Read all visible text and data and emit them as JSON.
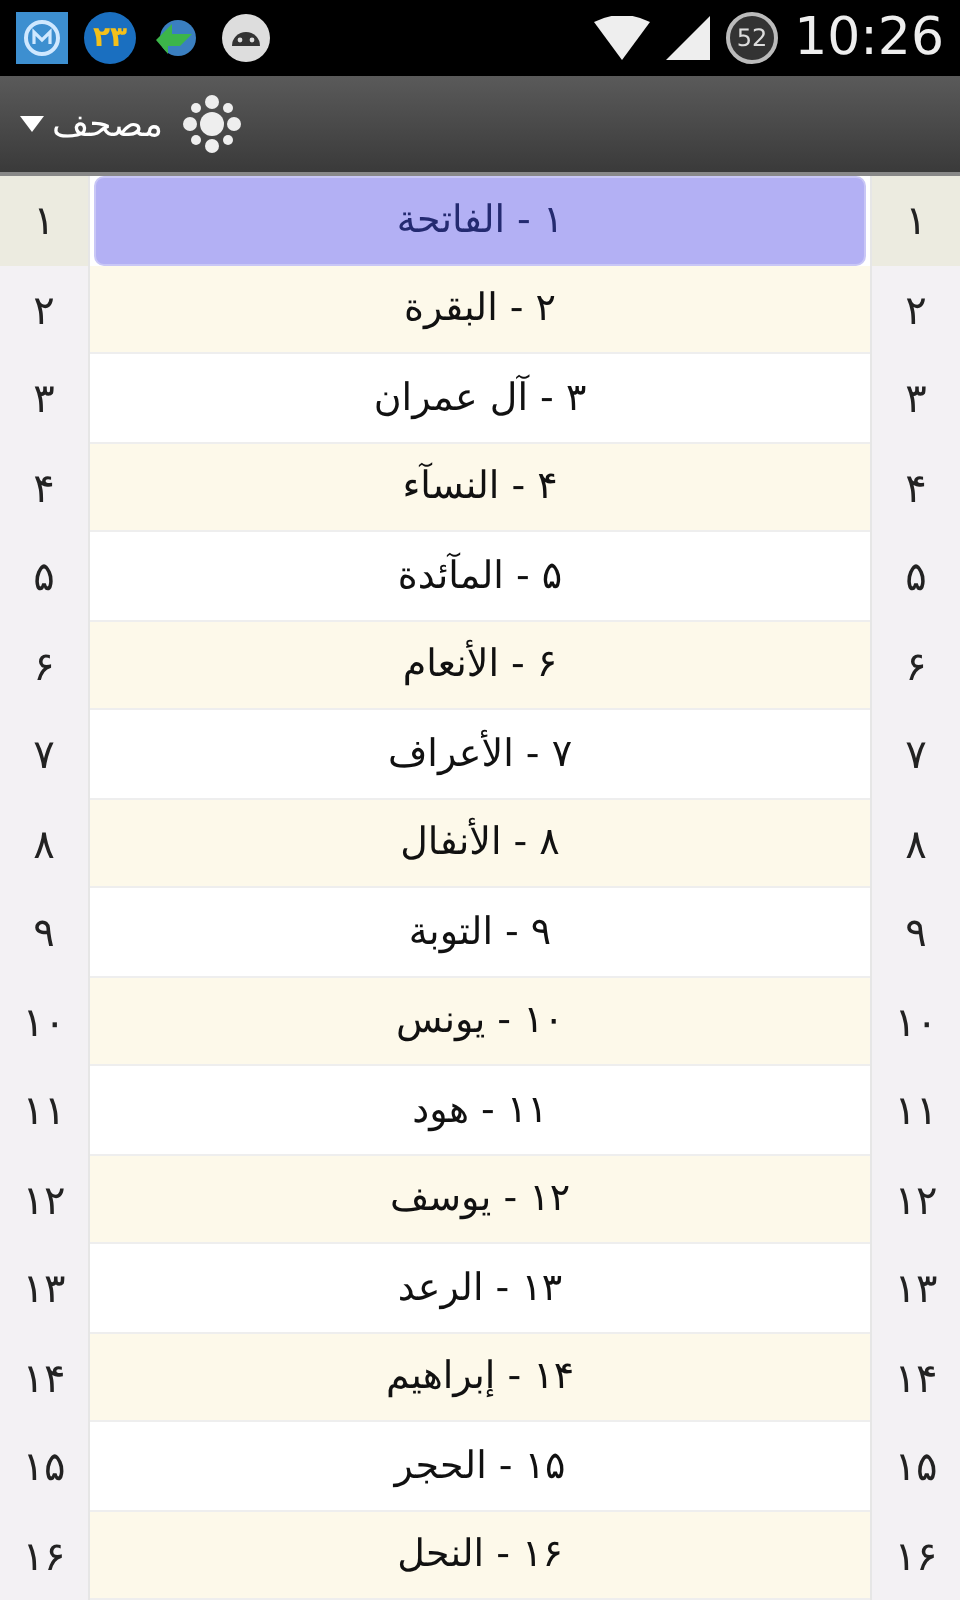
{
  "status_bar": {
    "notification_badge": "۲۳",
    "battery": "52",
    "time": "10:26"
  },
  "action_bar": {
    "title": "مصحف"
  },
  "left_index": [
    {
      "label": "۱",
      "selected": true
    },
    {
      "label": "۲",
      "selected": false
    },
    {
      "label": "۳",
      "selected": false
    },
    {
      "label": "۴",
      "selected": false
    },
    {
      "label": "۵",
      "selected": false
    },
    {
      "label": "۶",
      "selected": false
    },
    {
      "label": "۷",
      "selected": false
    },
    {
      "label": "۸",
      "selected": false
    },
    {
      "label": "۹",
      "selected": false
    },
    {
      "label": "۱۰",
      "selected": false
    },
    {
      "label": "۱۱",
      "selected": false
    },
    {
      "label": "۱۲",
      "selected": false
    },
    {
      "label": "۱۳",
      "selected": false
    },
    {
      "label": "۱۴",
      "selected": false
    },
    {
      "label": "۱۵",
      "selected": false
    },
    {
      "label": "۱۶",
      "selected": false
    }
  ],
  "surahs": [
    {
      "label": "۱ - الفاتحة",
      "selected": true
    },
    {
      "label": "۲ - البقرة",
      "selected": false
    },
    {
      "label": "۳ - آل عمران",
      "selected": false
    },
    {
      "label": "۴ - النسآء",
      "selected": false
    },
    {
      "label": "۵ - المآئدة",
      "selected": false
    },
    {
      "label": "۶ - الأنعام",
      "selected": false
    },
    {
      "label": "۷ - الأعراف",
      "selected": false
    },
    {
      "label": "۸ - الأنفال",
      "selected": false
    },
    {
      "label": "۹ - التوبة",
      "selected": false
    },
    {
      "label": "۱۰ - يونس",
      "selected": false
    },
    {
      "label": "۱۱ - هود",
      "selected": false
    },
    {
      "label": "۱۲ - يوسف",
      "selected": false
    },
    {
      "label": "۱۳ - الرعد",
      "selected": false
    },
    {
      "label": "۱۴ - إبراهيم",
      "selected": false
    },
    {
      "label": "۱۵ - الحجر",
      "selected": false
    },
    {
      "label": "۱۶ - النحل",
      "selected": false
    }
  ],
  "right_index": [
    {
      "label": "۱",
      "selected": true
    },
    {
      "label": "۲",
      "selected": false
    },
    {
      "label": "۳",
      "selected": false
    },
    {
      "label": "۴",
      "selected": false
    },
    {
      "label": "۵",
      "selected": false
    },
    {
      "label": "۶",
      "selected": false
    },
    {
      "label": "۷",
      "selected": false
    },
    {
      "label": "۸",
      "selected": false
    },
    {
      "label": "۹",
      "selected": false
    },
    {
      "label": "۱۰",
      "selected": false
    },
    {
      "label": "۱۱",
      "selected": false
    },
    {
      "label": "۱۲",
      "selected": false
    },
    {
      "label": "۱۳",
      "selected": false
    },
    {
      "label": "۱۴",
      "selected": false
    },
    {
      "label": "۱۵",
      "selected": false
    },
    {
      "label": "۱۶",
      "selected": false
    }
  ]
}
